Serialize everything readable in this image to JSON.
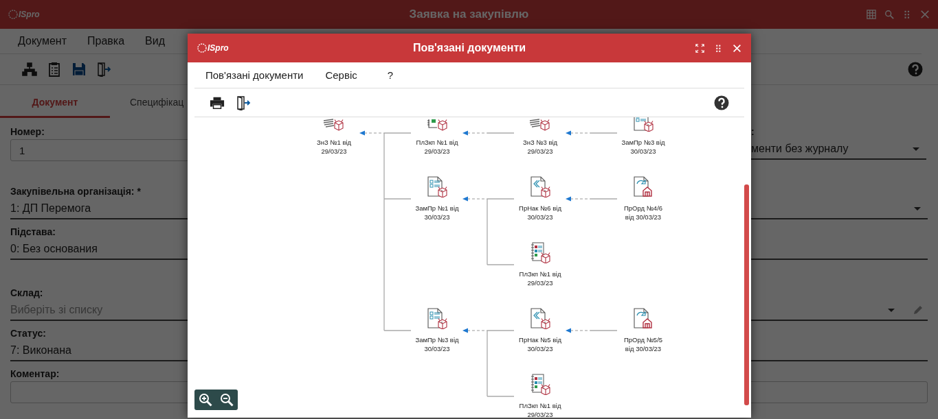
{
  "app": {
    "logo": "ISpro",
    "title": "Заявка на закупівлю",
    "menu": [
      "Документ",
      "Правка",
      "Вид"
    ],
    "tabs": [
      {
        "label": "Документ",
        "selected": true
      },
      {
        "label": "Специфікац",
        "selected": false
      }
    ],
    "form": {
      "top_row": [
        {
          "kind": "boxed",
          "label": "Номер:",
          "value": "1"
        },
        {
          "kind": "line",
          "label": ":",
          "value": "менти без журналу",
          "dropdown": true
        }
      ],
      "fields": [
        {
          "kind": "line",
          "label": "Закупівельна організація: *",
          "value": "1: ДП Перемога",
          "dropdown": true
        },
        {
          "kind": "line",
          "label": "Підстава:",
          "value": "0: Без основания",
          "dropdown": false
        },
        {
          "kind": "line",
          "label": "Склад:",
          "placeholder": "Виберіть зі списку",
          "dropdown": true,
          "editable": true
        },
        {
          "kind": "line",
          "label": "Статус:",
          "value": "7: Виконана",
          "dropdown": false
        },
        {
          "kind": "boxed",
          "label": "Коментар:"
        }
      ]
    }
  },
  "dialog": {
    "logo": "ISpro",
    "title": "Пов'язані документи",
    "menu": [
      "Пов'язані документи",
      "Сервіс",
      "?"
    ],
    "tree": {
      "kind": "request",
      "label": [
        "ЗнЗ №1 від",
        "29/03/23"
      ],
      "children": [
        {
          "kind": "plan",
          "label": [
            "ПлЗкп №1 від",
            "29/03/23"
          ],
          "children": [
            {
              "kind": "request",
              "label": [
                "ЗнЗ №3 від",
                "29/03/23"
              ],
              "children": [
                {
                  "kind": "order",
                  "label": [
                    "ЗамПр №3 від",
                    "30/03/23"
                  ]
                }
              ]
            }
          ]
        },
        {
          "kind": "order",
          "label": [
            "ЗамПр №1 від",
            "30/03/23"
          ],
          "children": [
            {
              "kind": "receipt",
              "label": [
                "ПрНак №6 від",
                "30/03/23"
              ],
              "children": [
                {
                  "kind": "warehouse",
                  "label": [
                    "ПрОрд №4/6",
                    "від 30/03/23"
                  ]
                }
              ]
            },
            {
              "kind": "notebook",
              "label": [
                "ПлЗкп №1 від",
                "29/03/23"
              ]
            }
          ]
        },
        {
          "kind": "order",
          "label": [
            "ЗамПр №3 від",
            "30/03/23"
          ],
          "children": [
            {
              "kind": "receipt",
              "label": [
                "ПрНак №5 від",
                "30/03/23"
              ],
              "children": [
                {
                  "kind": "warehouse",
                  "label": [
                    "ПрОрд №5/5",
                    "від 30/03/23"
                  ]
                }
              ]
            },
            {
              "kind": "notebook",
              "label": [
                "ПлЗкп №1 від",
                "29/03/23"
              ]
            }
          ]
        }
      ]
    }
  }
}
